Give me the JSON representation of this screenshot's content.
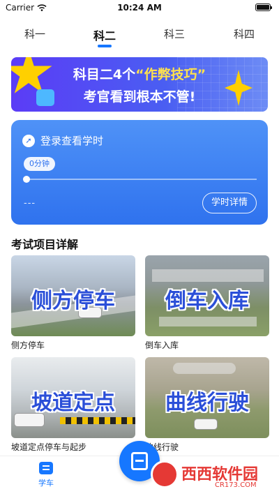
{
  "status_bar": {
    "carrier": "Carrier",
    "time": "10:24 AM",
    "battery_level": 1.0
  },
  "tabs": [
    {
      "label": "科一",
      "active": false
    },
    {
      "label": "科二",
      "active": true
    },
    {
      "label": "科三",
      "active": false
    },
    {
      "label": "科四",
      "active": false
    }
  ],
  "banner": {
    "line1_prefix": "科目二4个",
    "line1_highlight": "“作弊技巧”",
    "line2": "考官看到根本不管!"
  },
  "study_card": {
    "login_text": "登录查看学时",
    "minutes": "0分钟",
    "progress": 0,
    "placeholder": "---",
    "detail_button": "学时详情"
  },
  "section": {
    "title": "考试项目详解",
    "items": [
      {
        "thumb_label": "侧方停车",
        "caption": "侧方停车"
      },
      {
        "thumb_label": "倒车入库",
        "caption": "倒车入库"
      },
      {
        "thumb_label": "坡道定点",
        "caption": "坡道定点停车与起步"
      },
      {
        "thumb_label": "曲线行驶",
        "caption": "曲线行驶"
      }
    ]
  },
  "tabbar": {
    "learn_label": "学车"
  },
  "watermark": {
    "text": "西西软件园",
    "sub": "CR173.COM"
  },
  "colors": {
    "accent": "#1677ff",
    "card": "#3b7ff2",
    "banner": "#5b3cf6"
  }
}
